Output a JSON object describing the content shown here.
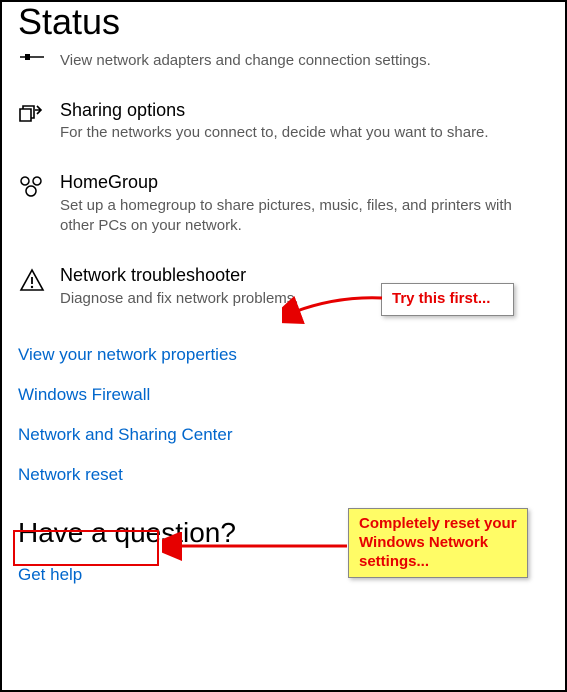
{
  "header": {
    "title": "Status"
  },
  "sections": {
    "adapters": {
      "title": "",
      "desc": "View network adapters and change connection settings."
    },
    "sharing": {
      "title": "Sharing options",
      "desc": "For the networks you connect to, decide what you want to share."
    },
    "homegroup": {
      "title": "HomeGroup",
      "desc": "Set up a homegroup to share pictures, music, files, and printers with other PCs on your network."
    },
    "troubleshooter": {
      "title": "Network troubleshooter",
      "desc": "Diagnose and fix network problems."
    }
  },
  "links": {
    "view_properties": "View your network properties",
    "firewall": "Windows Firewall",
    "sharing_center": "Network and Sharing Center",
    "network_reset": "Network reset"
  },
  "question": {
    "title": "Have a question?",
    "get_help": "Get help"
  },
  "annotations": {
    "try_first": "Try this first...",
    "reset_hint": "Completely reset your Windows Network settings..."
  }
}
